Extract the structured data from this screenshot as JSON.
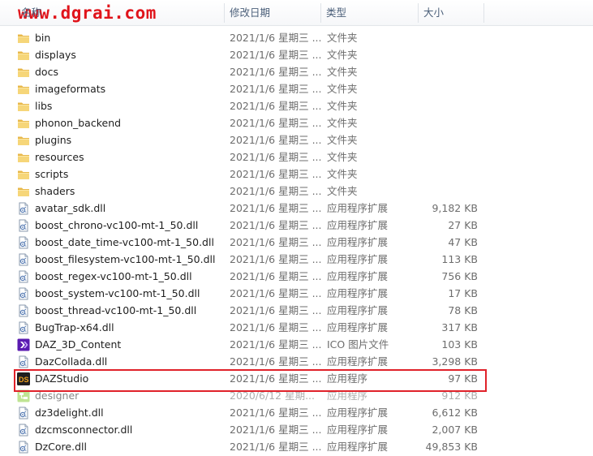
{
  "watermark": "www.dgrai.com",
  "columns": {
    "name": "名称",
    "date": "修改日期",
    "type": "类型",
    "size": "大小"
  },
  "files": [
    {
      "name": "bin",
      "date": "2021/1/6 星期三 ...",
      "type": "文件夹",
      "size": "",
      "icon": "folder-icon"
    },
    {
      "name": "displays",
      "date": "2021/1/6 星期三 ...",
      "type": "文件夹",
      "size": "",
      "icon": "folder-icon"
    },
    {
      "name": "docs",
      "date": "2021/1/6 星期三 ...",
      "type": "文件夹",
      "size": "",
      "icon": "folder-icon"
    },
    {
      "name": "imageformats",
      "date": "2021/1/6 星期三 ...",
      "type": "文件夹",
      "size": "",
      "icon": "folder-icon"
    },
    {
      "name": "libs",
      "date": "2021/1/6 星期三 ...",
      "type": "文件夹",
      "size": "",
      "icon": "folder-icon"
    },
    {
      "name": "phonon_backend",
      "date": "2021/1/6 星期三 ...",
      "type": "文件夹",
      "size": "",
      "icon": "folder-icon"
    },
    {
      "name": "plugins",
      "date": "2021/1/6 星期三 ...",
      "type": "文件夹",
      "size": "",
      "icon": "folder-icon"
    },
    {
      "name": "resources",
      "date": "2021/1/6 星期三 ...",
      "type": "文件夹",
      "size": "",
      "icon": "folder-icon"
    },
    {
      "name": "scripts",
      "date": "2021/1/6 星期三 ...",
      "type": "文件夹",
      "size": "",
      "icon": "folder-icon"
    },
    {
      "name": "shaders",
      "date": "2021/1/6 星期三 ...",
      "type": "文件夹",
      "size": "",
      "icon": "folder-icon"
    },
    {
      "name": "avatar_sdk.dll",
      "date": "2021/1/6 星期三 ...",
      "type": "应用程序扩展",
      "size": "9,182 KB",
      "icon": "dll-icon"
    },
    {
      "name": "boost_chrono-vc100-mt-1_50.dll",
      "date": "2021/1/6 星期三 ...",
      "type": "应用程序扩展",
      "size": "27 KB",
      "icon": "dll-icon"
    },
    {
      "name": "boost_date_time-vc100-mt-1_50.dll",
      "date": "2021/1/6 星期三 ...",
      "type": "应用程序扩展",
      "size": "47 KB",
      "icon": "dll-icon"
    },
    {
      "name": "boost_filesystem-vc100-mt-1_50.dll",
      "date": "2021/1/6 星期三 ...",
      "type": "应用程序扩展",
      "size": "113 KB",
      "icon": "dll-icon"
    },
    {
      "name": "boost_regex-vc100-mt-1_50.dll",
      "date": "2021/1/6 星期三 ...",
      "type": "应用程序扩展",
      "size": "756 KB",
      "icon": "dll-icon"
    },
    {
      "name": "boost_system-vc100-mt-1_50.dll",
      "date": "2021/1/6 星期三 ...",
      "type": "应用程序扩展",
      "size": "17 KB",
      "icon": "dll-icon"
    },
    {
      "name": "boost_thread-vc100-mt-1_50.dll",
      "date": "2021/1/6 星期三 ...",
      "type": "应用程序扩展",
      "size": "78 KB",
      "icon": "dll-icon"
    },
    {
      "name": "BugTrap-x64.dll",
      "date": "2021/1/6 星期三 ...",
      "type": "应用程序扩展",
      "size": "317 KB",
      "icon": "dll-icon"
    },
    {
      "name": "DAZ_3D_Content",
      "date": "2021/1/6 星期三 ...",
      "type": "ICO 图片文件",
      "size": "103 KB",
      "icon": "daz-ico-icon"
    },
    {
      "name": "DazCollada.dll",
      "date": "2021/1/6 星期三 ...",
      "type": "应用程序扩展",
      "size": "3,298 KB",
      "icon": "dll-icon"
    },
    {
      "name": "DAZStudio",
      "date": "2021/1/6 星期三 ...",
      "type": "应用程序",
      "size": "97 KB",
      "icon": "daz-studio-icon"
    },
    {
      "name": "designer",
      "date": "2020/6/12 星期...",
      "type": "应用程序",
      "size": "912 KB",
      "icon": "designer-icon"
    },
    {
      "name": "dz3delight.dll",
      "date": "2021/1/6 星期三 ...",
      "type": "应用程序扩展",
      "size": "6,612 KB",
      "icon": "dll-icon"
    },
    {
      "name": "dzcmsconnector.dll",
      "date": "2021/1/6 星期三 ...",
      "type": "应用程序扩展",
      "size": "2,007 KB",
      "icon": "dll-icon"
    },
    {
      "name": "DzCore.dll",
      "date": "2021/1/6 星期三 ...",
      "type": "应用程序扩展",
      "size": "49,853 KB",
      "icon": "dll-icon"
    }
  ]
}
